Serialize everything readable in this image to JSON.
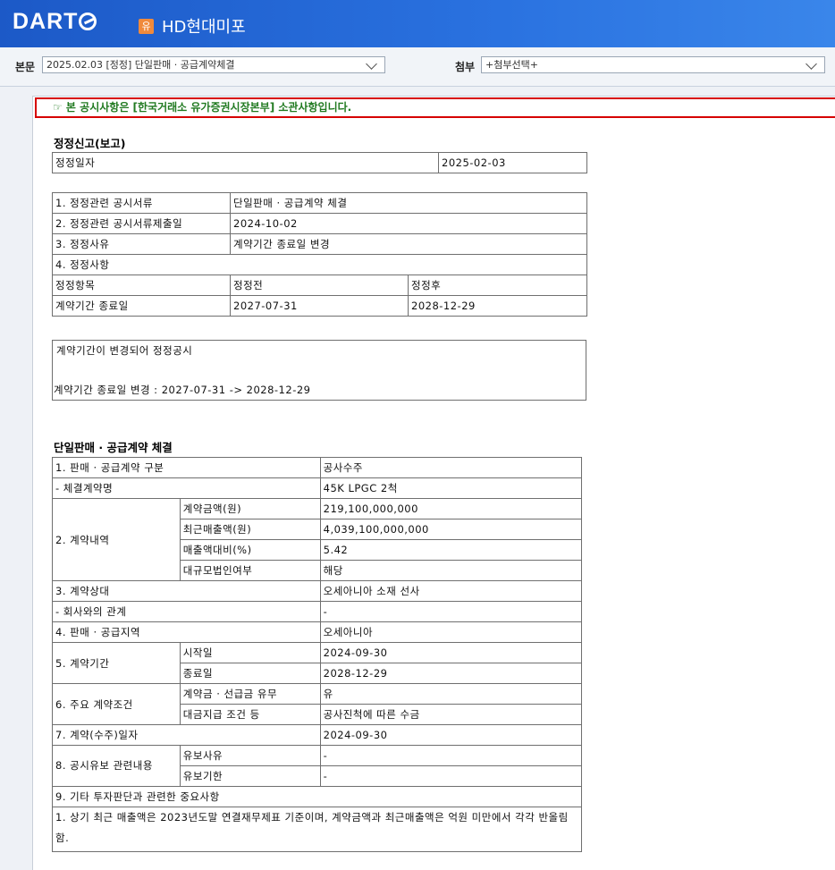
{
  "header": {
    "logo": "DART",
    "badge": "유",
    "company": "HD현대미포"
  },
  "selectors": {
    "main_label": "본문",
    "main_value": "2025.02.03 [정정] 단일판매 · 공급계약체결",
    "attach_label": "첨부",
    "attach_value": "+첨부선택+"
  },
  "notice": "☞ 본 공시사항은 [한국거래소 유가증권시장본부] 소관사항입니다.",
  "correction": {
    "title": "정정신고(보고)",
    "date_label": "정정일자",
    "date_value": "2025-02-03",
    "rows": [
      {
        "label": "1. 정정관련 공시서류",
        "value": "단일판매 · 공급계약 체결"
      },
      {
        "label": "2. 정정관련 공시서류제출일",
        "value": "2024-10-02"
      },
      {
        "label": "3. 정정사유",
        "value": "계약기간 종료일 변경"
      }
    ],
    "items_label": "4. 정정사항",
    "cols": [
      "정정항목",
      "정정전",
      "정정후"
    ],
    "item": [
      "계약기간 종료일",
      "2027-07-31",
      "2028-12-29"
    ],
    "note_line1": "계약기간이 변경되어 정정공시",
    "note_line2": "계약기간 종료일 변경 : 2027-07-31 -> 2028-12-29"
  },
  "contract": {
    "title": "단일판매 · 공급계약 체결",
    "type_label": "1. 판매 · 공급계약 구분",
    "type_value": "공사수주",
    "name_label": "- 체결계약명",
    "name_value": "45K LPGC 2척",
    "details_label": "2. 계약내역",
    "details": [
      {
        "label": "계약금액(원)",
        "value": "219,100,000,000"
      },
      {
        "label": "최근매출액(원)",
        "value": "4,039,100,000,000"
      },
      {
        "label": "매출액대비(%)",
        "value": "5.42"
      },
      {
        "label": "대규모법인여부",
        "value": "해당"
      }
    ],
    "party_label": "3. 계약상대",
    "party_value": "오세아니아 소재 선사",
    "relation_label": "- 회사와의 관계",
    "relation_value": "-",
    "region_label": "4. 판매 · 공급지역",
    "region_value": "오세아니아",
    "period_label": "5. 계약기간",
    "start_label": "시작일",
    "start_value": "2024-09-30",
    "end_label": "종료일",
    "end_value": "2028-12-29",
    "terms_label": "6. 주요 계약조건",
    "deposit_label": "계약금 · 선급금 유무",
    "deposit_value": "유",
    "payment_label": "대금지급 조건 등",
    "payment_value": "공사진척에 따른 수금",
    "date_label": "7. 계약(수주)일자",
    "date_value": "2024-09-30",
    "reserve_label": "8. 공시유보 관련내용",
    "reserve_reason_label": "유보사유",
    "reserve_reason_value": "-",
    "reserve_period_label": "유보기한",
    "reserve_period_value": "-",
    "other_label": "9. 기타 투자판단과 관련한 중요사항",
    "other_text": "1. 상기 최근 매출액은 2023년도말 연결재무제표 기준이며, 계약금액과 최근매출액은 억원 미만에서 각각 반올림함."
  }
}
